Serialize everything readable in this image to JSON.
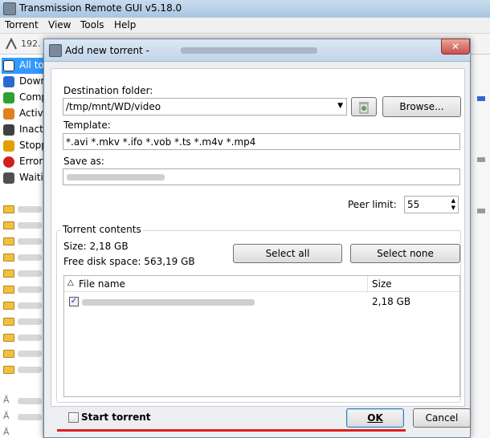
{
  "main_window": {
    "title": "Transmission Remote GUI v5.18.0",
    "menu": [
      "Torrent",
      "View",
      "Tools",
      "Help"
    ],
    "toolbar_text": "192.",
    "sidebar": [
      {
        "label": "All to",
        "icon": "all-torrents-icon",
        "color": "#4060c0"
      },
      {
        "label": "Down",
        "icon": "download-icon",
        "color": "#2a6ad0"
      },
      {
        "label": "Comp",
        "icon": "completed-icon",
        "color": "#30a030"
      },
      {
        "label": "Activ",
        "icon": "active-icon",
        "color": "#e08020"
      },
      {
        "label": "Inact",
        "icon": "inactive-icon",
        "color": "#404040"
      },
      {
        "label": "Stopp",
        "icon": "stopped-icon",
        "color": "#e0a000"
      },
      {
        "label": "Error",
        "icon": "error-icon",
        "color": "#d02020"
      },
      {
        "label": "Waiti",
        "icon": "waiting-icon",
        "color": "#505050"
      }
    ]
  },
  "dialog": {
    "title": "Add new torrent - ",
    "close_label": "✕",
    "destination_label": "Destination folder:",
    "destination_value": "/tmp/mnt/WD/video",
    "browse_label": "Browse...",
    "template_label": "Template:",
    "template_value": "*.avi *.mkv *.ifo *.vob *.ts *.m4v *.mp4",
    "saveas_label": "Save as:",
    "peer_limit_label": "Peer limit:",
    "peer_limit_value": "55",
    "contents_group": "Torrent contents",
    "size_text": "Size: 2,18 GB",
    "free_space_text": "Free disk space: 563,19 GB",
    "select_all": "Select all",
    "select_none": "Select none",
    "columns": {
      "name": "File name",
      "size": "Size"
    },
    "file_size": "2,18 GB",
    "start_torrent_label": "Start torrent",
    "ok_label": "OK",
    "cancel_label": "Cancel",
    "accent_underline": "#e02020"
  }
}
